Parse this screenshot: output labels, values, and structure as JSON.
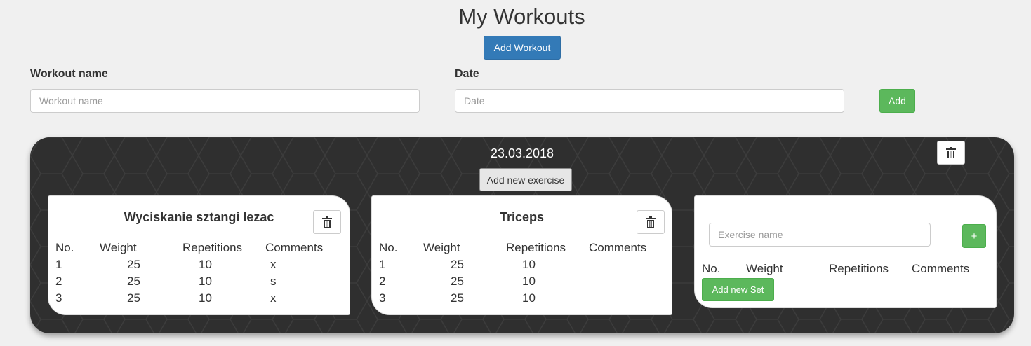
{
  "header": {
    "title": "My Workouts",
    "add_workout_label": "Add Workout"
  },
  "form": {
    "name_label": "Workout name",
    "name_placeholder": "Workout name",
    "date_label": "Date",
    "date_placeholder": "Date",
    "add_label": "Add"
  },
  "workout": {
    "date": "23.03.2018",
    "add_exercise_label": "Add new exercise",
    "headers": {
      "no": "No.",
      "weight": "Weight",
      "reps": "Repetitions",
      "comments": "Comments"
    },
    "exercises": [
      {
        "name": "Wyciskanie sztangi lezac",
        "sets": [
          {
            "no": "1",
            "weight": "25",
            "reps": "10",
            "comment": "x"
          },
          {
            "no": "2",
            "weight": "25",
            "reps": "10",
            "comment": "s"
          },
          {
            "no": "3",
            "weight": "25",
            "reps": "10",
            "comment": "x"
          }
        ]
      },
      {
        "name": "Triceps",
        "sets": [
          {
            "no": "1",
            "weight": "25",
            "reps": "10",
            "comment": ""
          },
          {
            "no": "2",
            "weight": "25",
            "reps": "10",
            "comment": ""
          },
          {
            "no": "3",
            "weight": "25",
            "reps": "10",
            "comment": ""
          }
        ]
      }
    ],
    "new_exercise": {
      "placeholder": "Exercise name",
      "plus_label": "+",
      "add_set_label": "Add new Set"
    }
  },
  "colors": {
    "primary": "#337ab7",
    "success": "#5cb85c",
    "board": "#2f2f2f"
  },
  "icons": {
    "trash": "trash-icon"
  }
}
